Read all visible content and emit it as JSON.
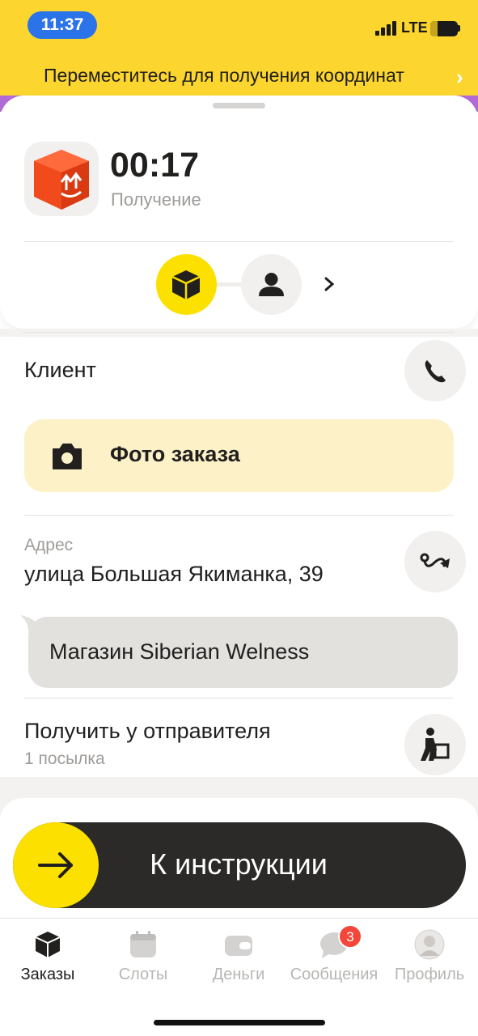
{
  "status_bar": {
    "time": "11:37",
    "network": "LTE",
    "battery": "26",
    "battery_level": 0.26
  },
  "notice": {
    "text": "Переместитесь для получения координат",
    "chevron_icon": "chevron-right-icon"
  },
  "order": {
    "timer": "00:17",
    "stage": "Получение",
    "icon": "parcel-box-icon",
    "steps": [
      {
        "icon": "package-icon",
        "active": true
      },
      {
        "icon": "person-icon",
        "active": false
      }
    ]
  },
  "client": {
    "title": "Клиент",
    "action_icon": "phone-icon"
  },
  "photo": {
    "label": "Фото заказа",
    "icon": "camera-icon"
  },
  "address": {
    "label": "Адрес",
    "value": "улица Большая Якиманка, 39",
    "action_icon": "route-icon",
    "comment": "Магазин Siberian Welness"
  },
  "pickup": {
    "title": "Получить у отправителя",
    "subtitle": "1 посылка",
    "action_icon": "carry-box-icon"
  },
  "swipe": {
    "label": "К инструкции",
    "icon": "arrow-right-icon"
  },
  "tabs": [
    {
      "label": "Заказы",
      "icon": "package-icon",
      "active": true
    },
    {
      "label": "Слоты",
      "icon": "calendar-icon",
      "active": false
    },
    {
      "label": "Деньги",
      "icon": "wallet-icon",
      "active": false
    },
    {
      "label": "Сообщения",
      "icon": "chat-icon",
      "active": false,
      "badge": "3"
    },
    {
      "label": "Профиль",
      "icon": "avatar-icon",
      "active": false
    }
  ],
  "colors": {
    "accent": "#fce000",
    "status_bar": "#fcd52e",
    "dark": "#21201f",
    "photo_bg": "#fdf1c8",
    "badge": "#f2473a"
  }
}
